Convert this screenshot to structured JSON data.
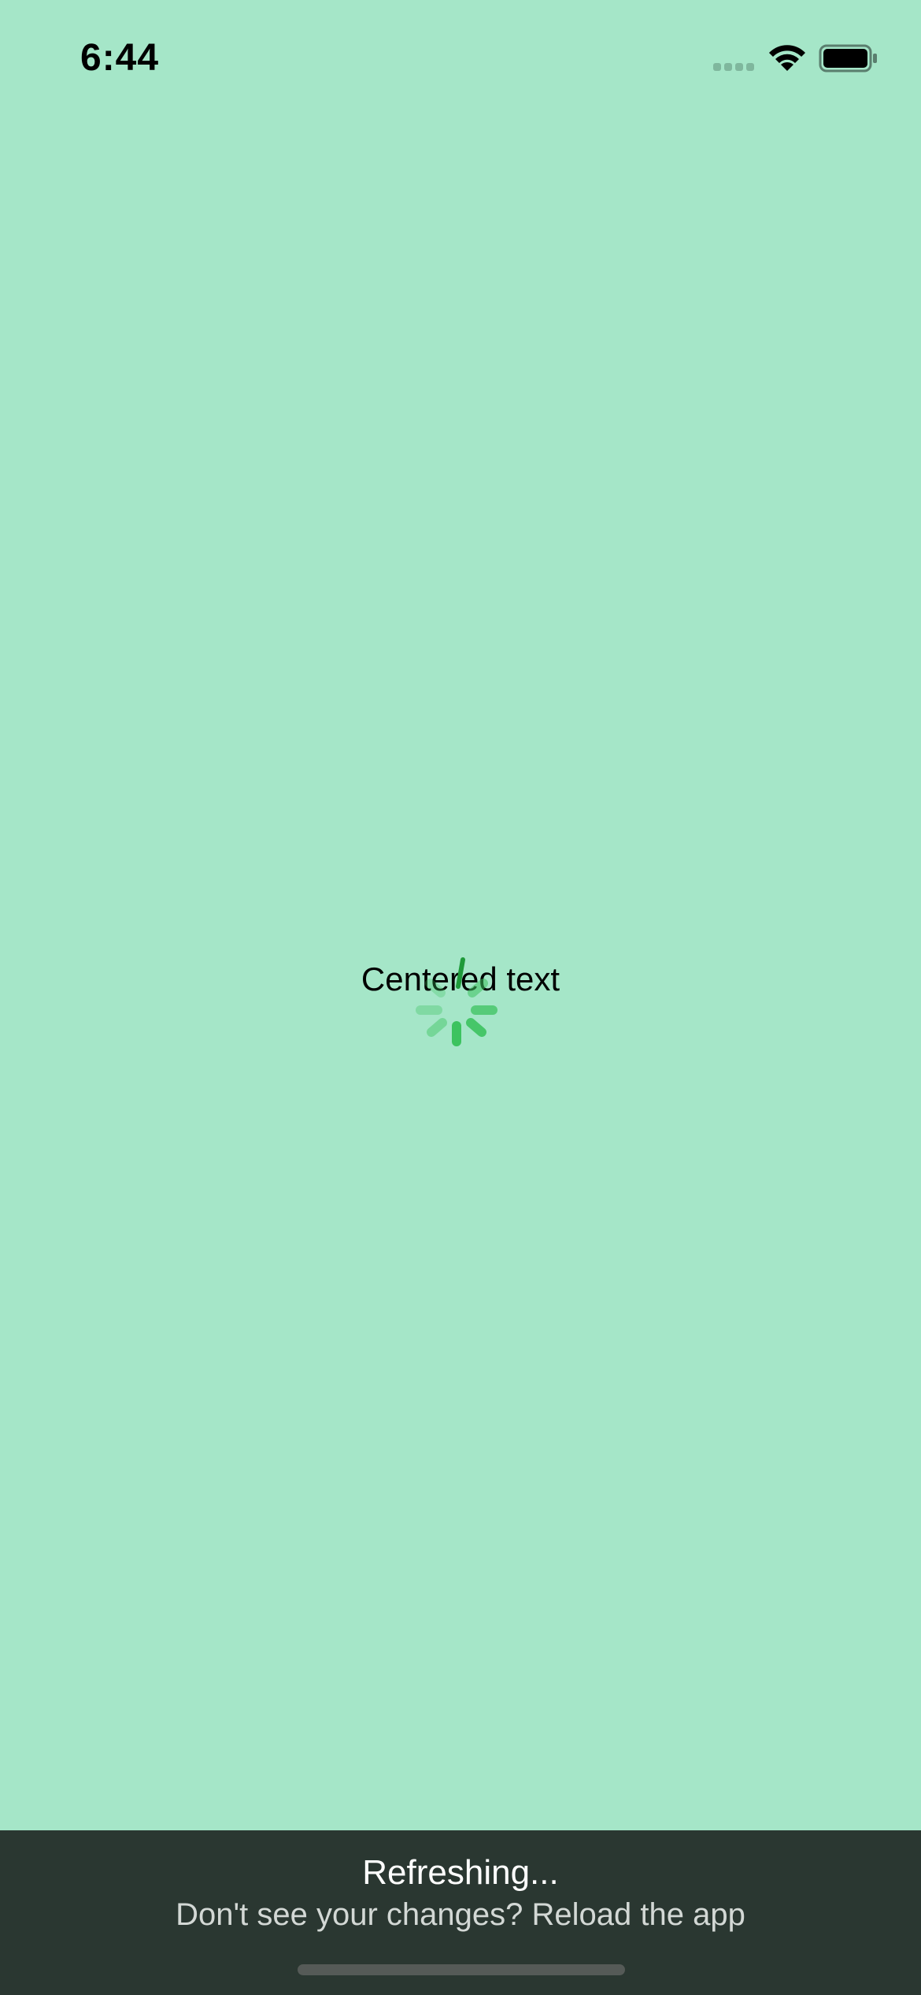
{
  "status_bar": {
    "time": "6:44",
    "icons": [
      "cellular-signal-icon",
      "wifi-icon",
      "battery-icon"
    ]
  },
  "content": {
    "centered_text": "Centered text",
    "spinner_icon": "loading-spinner-icon",
    "spinner_color": "#3cc35f"
  },
  "refresh_banner": {
    "title": "Refreshing...",
    "subtitle": "Don't see your changes? Reload the app",
    "background": "#2a3731"
  },
  "colors": {
    "background": "#a5e6c8"
  }
}
